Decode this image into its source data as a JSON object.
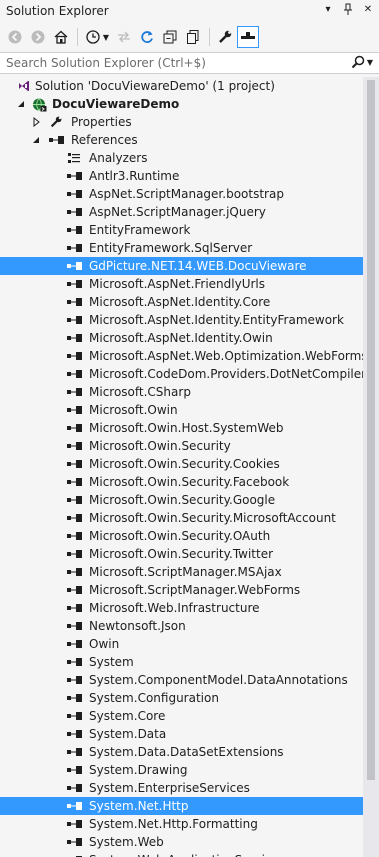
{
  "window": {
    "title": "Solution Explorer",
    "buttons": [
      "dropdown",
      "pin",
      "close"
    ]
  },
  "search": {
    "placeholder": "Search Solution Explorer (Ctrl+$)"
  },
  "colors": {
    "selection": "#3399ff",
    "background": "#f5f5f5",
    "reference_icon": "#1e1e1e"
  },
  "tree": {
    "solution": "Solution 'DocuViewareDemo' (1 project)",
    "project": "DocuViewareDemo",
    "properties": "Properties",
    "references": "References",
    "analyzers": "Analyzers",
    "items": [
      "Antlr3.Runtime",
      "AspNet.ScriptManager.bootstrap",
      "AspNet.ScriptManager.jQuery",
      "EntityFramework",
      "EntityFramework.SqlServer",
      "GdPicture.NET.14.WEB.DocuVieware",
      "Microsoft.AspNet.FriendlyUrls",
      "Microsoft.AspNet.Identity.Core",
      "Microsoft.AspNet.Identity.EntityFramework",
      "Microsoft.AspNet.Identity.Owin",
      "Microsoft.AspNet.Web.Optimization.WebForms",
      "Microsoft.CodeDom.Providers.DotNetCompilerPlat",
      "Microsoft.CSharp",
      "Microsoft.Owin",
      "Microsoft.Owin.Host.SystemWeb",
      "Microsoft.Owin.Security",
      "Microsoft.Owin.Security.Cookies",
      "Microsoft.Owin.Security.Facebook",
      "Microsoft.Owin.Security.Google",
      "Microsoft.Owin.Security.MicrosoftAccount",
      "Microsoft.Owin.Security.OAuth",
      "Microsoft.Owin.Security.Twitter",
      "Microsoft.ScriptManager.MSAjax",
      "Microsoft.ScriptManager.WebForms",
      "Microsoft.Web.Infrastructure",
      "Newtonsoft.Json",
      "Owin",
      "System",
      "System.ComponentModel.DataAnnotations",
      "System.Configuration",
      "System.Core",
      "System.Data",
      "System.Data.DataSetExtensions",
      "System.Drawing",
      "System.EnterpriseServices",
      "System.Net.Http",
      "System.Net.Http.Formatting",
      "System.Web",
      "System.Web.ApplicationServices"
    ],
    "selected": [
      "GdPicture.NET.14.WEB.DocuVieware",
      "System.Net.Http"
    ]
  }
}
